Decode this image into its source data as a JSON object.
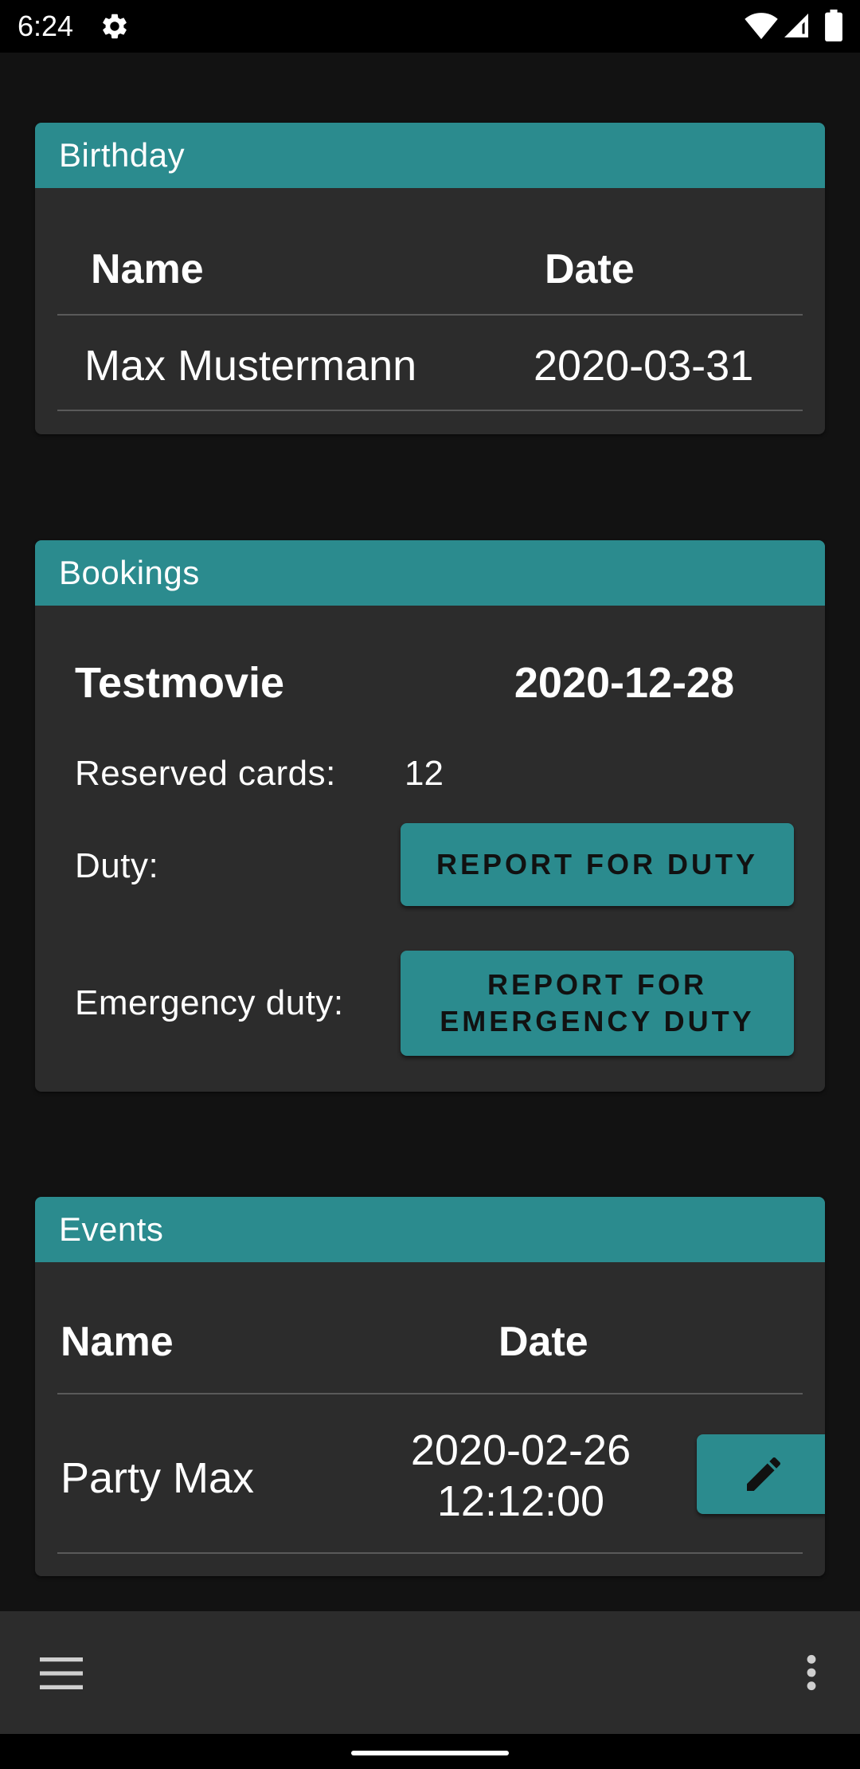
{
  "status_bar": {
    "time": "6:24",
    "icons": [
      "gear-icon",
      "wifi-icon",
      "signal-icon",
      "battery-icon"
    ]
  },
  "colors": {
    "accent": "#2b8b8e",
    "card_bg": "#2c2c2c",
    "page_bg": "#121212"
  },
  "birthday": {
    "title": "Birthday",
    "headers": {
      "name": "Name",
      "date": "Date"
    },
    "rows": [
      {
        "name": "Max Mustermann",
        "date": "2020-03-31"
      }
    ]
  },
  "bookings": {
    "title": "Bookings",
    "movie": "Testmovie",
    "date": "2020-12-28",
    "reserved_label": "Reserved cards:",
    "reserved_value": "12",
    "duty_label": "Duty:",
    "duty_button": "REPORT FOR DUTY",
    "emergency_label": "Emergency duty:",
    "emergency_button_line1": "REPORT FOR",
    "emergency_button_line2": "EMERGENCY DUTY"
  },
  "events": {
    "title": "Events",
    "headers": {
      "name": "Name",
      "date": "Date"
    },
    "rows": [
      {
        "name": "Party Max",
        "date": "2020-02-26",
        "time": "12:12:00",
        "action_icon": "edit-icon"
      }
    ]
  },
  "bottom_bar": {
    "left_icon": "menu-icon",
    "right_icon": "more-vert-icon"
  }
}
